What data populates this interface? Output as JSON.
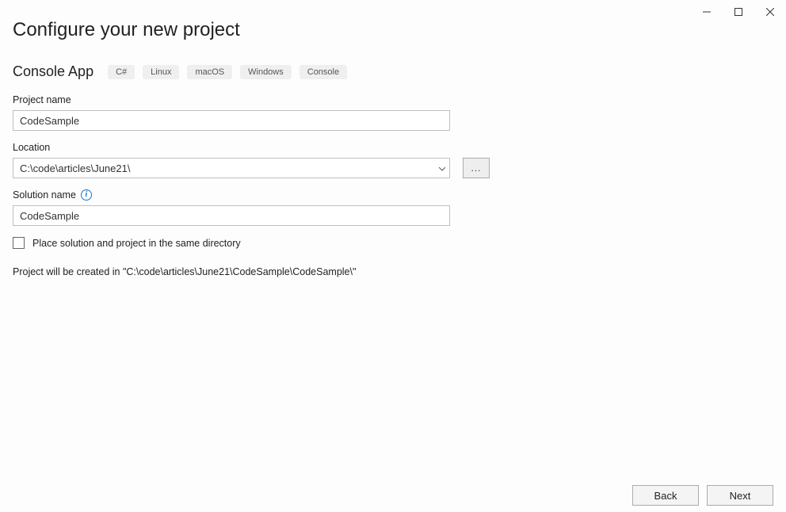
{
  "window": {
    "title": "Configure your new project"
  },
  "template": {
    "name": "Console App",
    "tags": [
      "C#",
      "Linux",
      "macOS",
      "Windows",
      "Console"
    ]
  },
  "fields": {
    "project_name": {
      "label": "Project name",
      "value": "CodeSample"
    },
    "location": {
      "label": "Location",
      "value": "C:\\code\\articles\\June21\\",
      "browse": "..."
    },
    "solution_name": {
      "label": "Solution name",
      "value": "CodeSample"
    },
    "same_dir": {
      "label": "Place solution and project in the same directory",
      "checked": false
    }
  },
  "summary": "Project will be created in \"C:\\code\\articles\\June21\\CodeSample\\CodeSample\\\"",
  "buttons": {
    "back": "Back",
    "next": "Next"
  }
}
